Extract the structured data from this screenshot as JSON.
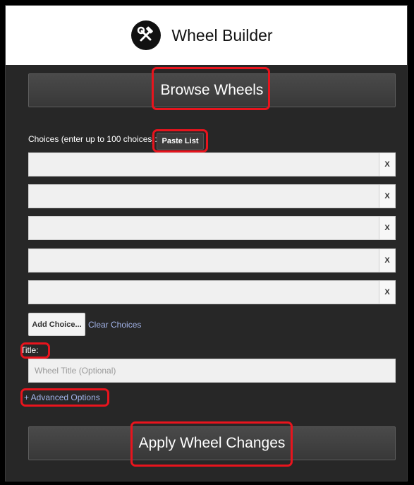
{
  "header": {
    "title": "Wheel Builder",
    "logo_icon": "hammer-wrench-icon"
  },
  "browse_button": {
    "label": "Browse Wheels"
  },
  "choices": {
    "label": "Choices (enter up to 100 choices):",
    "paste_label": "Paste List",
    "remove_label": "X",
    "items": [
      {
        "value": ""
      },
      {
        "value": ""
      },
      {
        "value": ""
      },
      {
        "value": ""
      },
      {
        "value": ""
      }
    ],
    "add_label": "Add Choice...",
    "clear_label": "Clear Choices"
  },
  "title_field": {
    "label": "Title:",
    "placeholder": "Wheel Title (Optional)",
    "value": ""
  },
  "advanced": {
    "label": "+ Advanced Options"
  },
  "apply_button": {
    "label": "Apply Wheel Changes"
  },
  "colors": {
    "panel_bg": "#272727",
    "highlight": "#e8141d",
    "link": "#a3b4ea"
  }
}
